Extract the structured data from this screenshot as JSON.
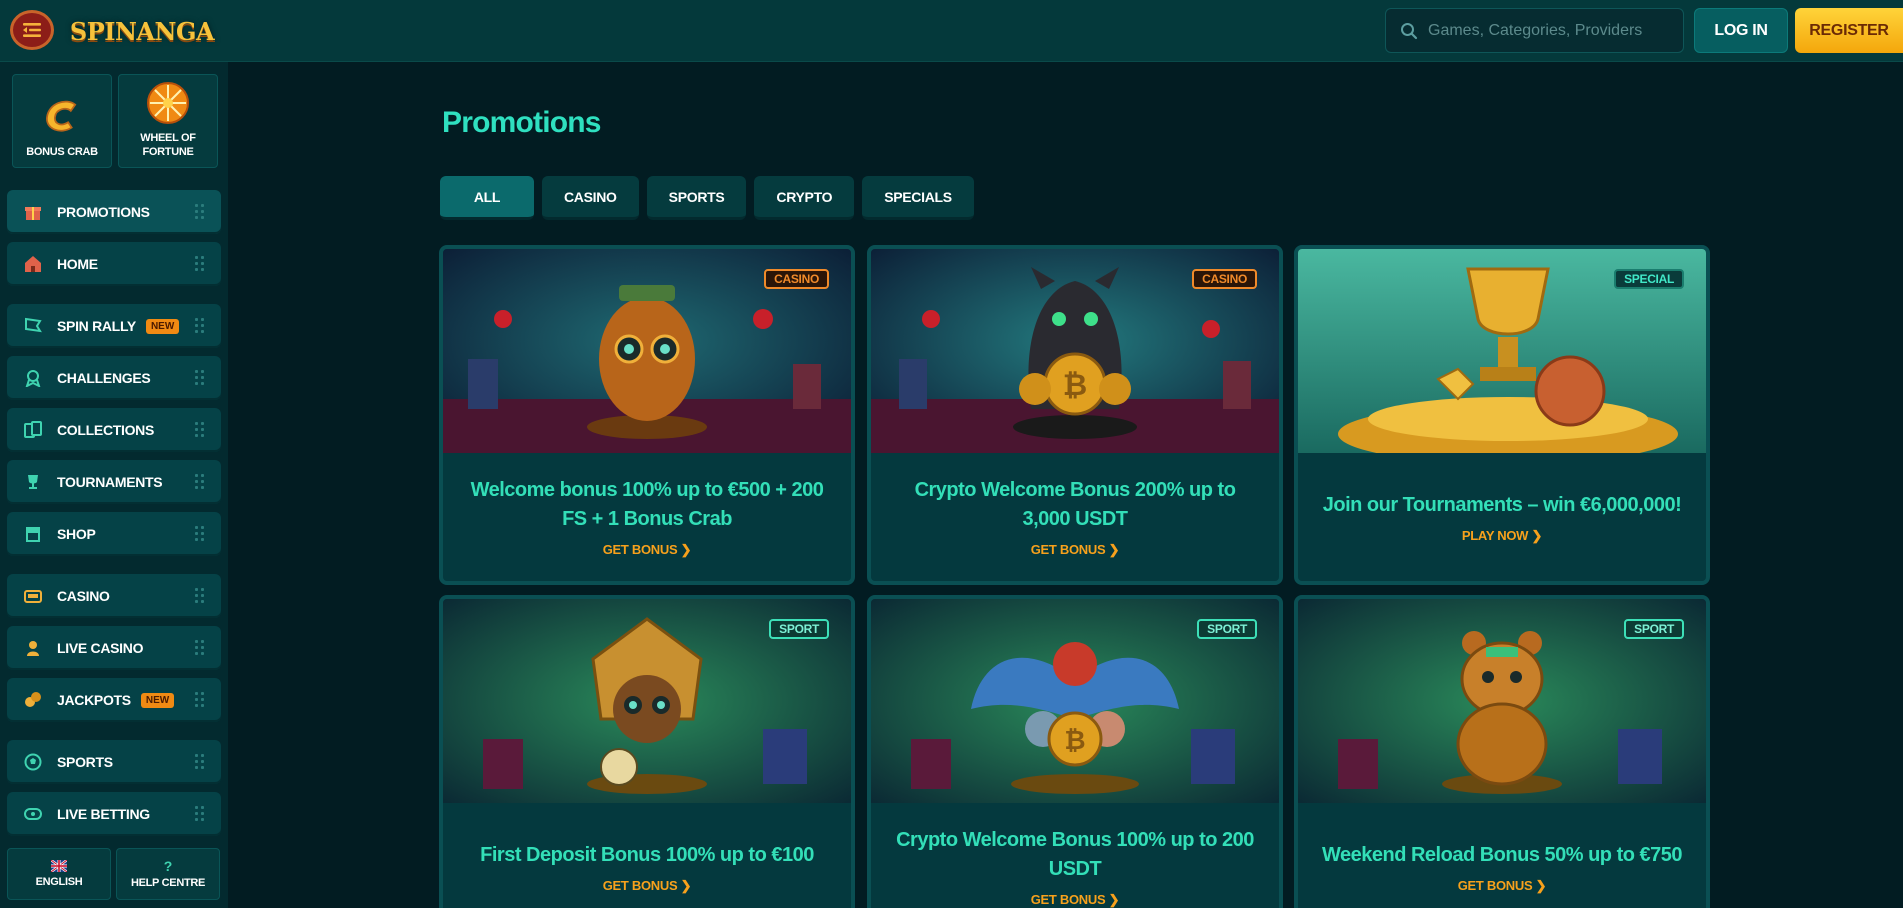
{
  "header": {
    "logo_text": "SPINANGA",
    "search_placeholder": "Games, Categories, Providers",
    "login_label": "LOG IN",
    "register_label": "REGISTER"
  },
  "sidebar": {
    "quick_links": [
      {
        "label": "BONUS CRAB",
        "icon": "bonus-crab-icon"
      },
      {
        "label": "WHEEL OF FORTUNE",
        "icon": "wheel-of-fortune-icon"
      }
    ],
    "items": [
      {
        "label": "PROMOTIONS",
        "icon": "gift-icon",
        "active": true
      },
      {
        "label": "HOME",
        "icon": "home-icon"
      },
      {
        "label": "SPIN RALLY",
        "icon": "race-flag-icon",
        "badge": "NEW"
      },
      {
        "label": "CHALLENGES",
        "icon": "medal-icon"
      },
      {
        "label": "COLLECTIONS",
        "icon": "cards-icon"
      },
      {
        "label": "TOURNAMENTS",
        "icon": "trophy-icon"
      },
      {
        "label": "SHOP",
        "icon": "shop-icon"
      },
      {
        "label": "CASINO",
        "icon": "casino-icon"
      },
      {
        "label": "LIVE CASINO",
        "icon": "dealer-icon"
      },
      {
        "label": "JACKPOTS",
        "icon": "coins-icon",
        "badge": "NEW"
      },
      {
        "label": "SPORTS",
        "icon": "soccer-ball-icon"
      },
      {
        "label": "LIVE BETTING",
        "icon": "live-icon"
      }
    ],
    "bottom": [
      {
        "label": "ENGLISH",
        "icon": "uk-flag-icon"
      },
      {
        "label": "HELP CENTRE",
        "icon": "question-icon"
      }
    ]
  },
  "main": {
    "title": "Promotions",
    "tabs": [
      "ALL",
      "CASINO",
      "SPORTS",
      "CRYPTO",
      "SPECIALS"
    ],
    "cards": [
      {
        "tag": "CASINO",
        "title": "Welcome bonus 100% up to €500 + 200 FS + 1 Bonus Crab",
        "cta": "GET BONUS"
      },
      {
        "tag": "CASINO",
        "title": "Crypto Welcome Bonus 200% up to 3,000 USDT",
        "cta": "GET BONUS"
      },
      {
        "tag": "SPECIAL",
        "title": "Join our Tournaments – win €6,000,000!",
        "cta": "PLAY NOW"
      },
      {
        "tag": "SPORT",
        "title": "First Deposit Bonus 100% up to €100",
        "cta": "GET BONUS"
      },
      {
        "tag": "SPORT",
        "title": "Crypto Welcome Bonus 100% up to 200 USDT",
        "cta": "GET BONUS"
      },
      {
        "tag": "SPORT",
        "title": "Weekend Reload Bonus 50% up to €750",
        "cta": "GET BONUS"
      }
    ]
  },
  "colors": {
    "accent": "#2fe0c0",
    "cta": "#f7a11c",
    "register": "#f4a70b",
    "background": "#021c22"
  }
}
